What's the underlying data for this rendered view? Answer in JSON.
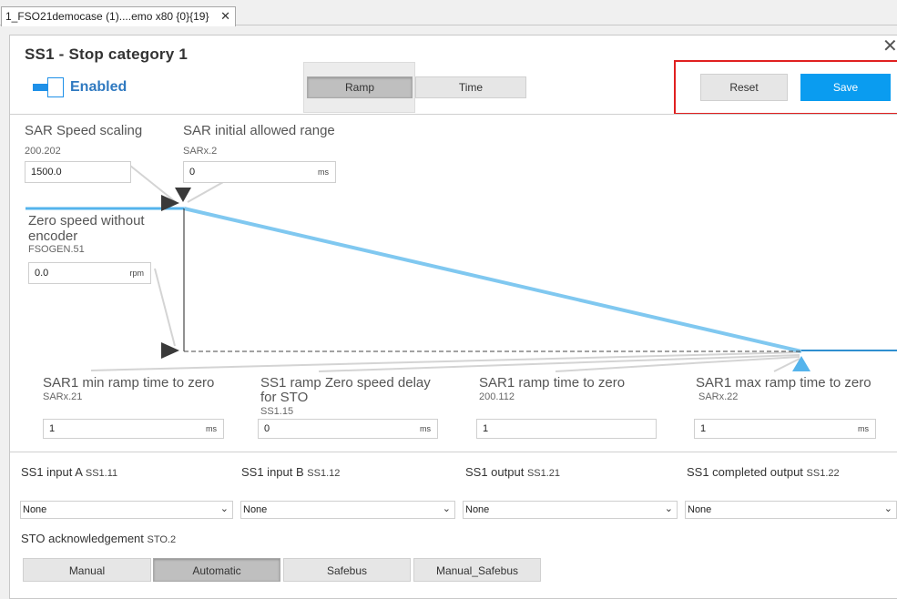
{
  "tab": {
    "title": "1_FSO21democase (1)....emo x80 {0}{19}",
    "close_glyph": "✕"
  },
  "dialog": {
    "title": "SS1 - Stop category 1",
    "close_glyph": "✕"
  },
  "toggle": {
    "label": "Enabled",
    "on": true
  },
  "mode_buttons": {
    "ramp": "Ramp",
    "time": "Time",
    "selected": "Ramp"
  },
  "actions": {
    "reset": "Reset",
    "save": "Save"
  },
  "params": {
    "speed_scaling": {
      "label": "SAR Speed scaling",
      "code": "200.202",
      "value": "1500.0",
      "unit": ""
    },
    "initial_range": {
      "label": "SAR initial allowed range",
      "code": "SARx.2",
      "value": "0",
      "unit": "ms"
    },
    "zero_speed": {
      "label_line1": "Zero speed without",
      "label_line2": "encoder",
      "code": "FSOGEN.51",
      "value": "0.0",
      "unit": "rpm"
    },
    "min_ramp": {
      "label": "SAR1 min ramp time to zero",
      "code": "SARx.21",
      "value": "1",
      "unit": "ms"
    },
    "zero_delay": {
      "label_line1": "SS1 ramp Zero speed delay",
      "label_line2": "for STO",
      "code": "SS1.15",
      "value": "0",
      "unit": "ms"
    },
    "ramp_time": {
      "label": "SAR1 ramp time to zero",
      "code": "200.112",
      "value": "1",
      "unit": ""
    },
    "max_ramp": {
      "label": "SAR1 max ramp time to zero",
      "code": "SARx.22",
      "value": "1",
      "unit": "ms"
    }
  },
  "io": {
    "input_a": {
      "label": "SS1 input A",
      "code": "SS1.11",
      "value": "None"
    },
    "input_b": {
      "label": "SS1 input B",
      "code": "SS1.12",
      "value": "None"
    },
    "output": {
      "label": "SS1 output",
      "code": "SS1.21",
      "value": "None"
    },
    "completed": {
      "label": "SS1 completed output",
      "code": "SS1.22",
      "value": "None"
    }
  },
  "ack": {
    "label": "STO acknowledgement",
    "code": "STO.2",
    "options": [
      "Manual",
      "Automatic",
      "Safebus",
      "Manual_Safebus"
    ],
    "selected": "Automatic"
  },
  "colors": {
    "accent": "#0a9cf0",
    "ramp_line": "#55b4ec",
    "highlight": "#e02020",
    "enabled_text": "#2f79c0"
  }
}
